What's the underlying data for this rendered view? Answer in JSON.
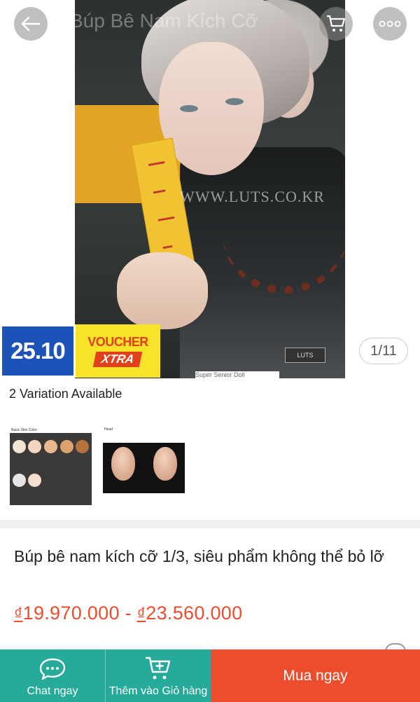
{
  "header": {
    "title": "Búp Bê Nam Kích Cỡ",
    "back_icon": "arrow-left-icon",
    "cart_icon": "cart-icon",
    "more_icon": "more-dots-icon"
  },
  "gallery": {
    "counter": "1/11",
    "watermark": "WWW.LUTS.CO.KR",
    "caption": "Super Senior Doll"
  },
  "promo": {
    "date": "25.10",
    "voucher_top": "VOUCHER",
    "voucher_bottom": "XTRA"
  },
  "variations": {
    "label": "2 Variation Available"
  },
  "product": {
    "title": "Búp bê nam kích cỡ 1/3, siêu phẩm không thể bỏ lỡ",
    "price_low": "19.970.000",
    "price_high": "23.560.000",
    "currency": "₫",
    "price_separator": " - "
  },
  "bottom_bar": {
    "chat_label": "Chat ngay",
    "add_cart_label": "Thêm vào Giỏ hàng",
    "buy_label": "Mua ngay"
  },
  "colors": {
    "accent": "#ee4d2d",
    "teal": "#26aa99",
    "promo_blue": "#1d52b8",
    "promo_yellow": "#f6e32a"
  }
}
